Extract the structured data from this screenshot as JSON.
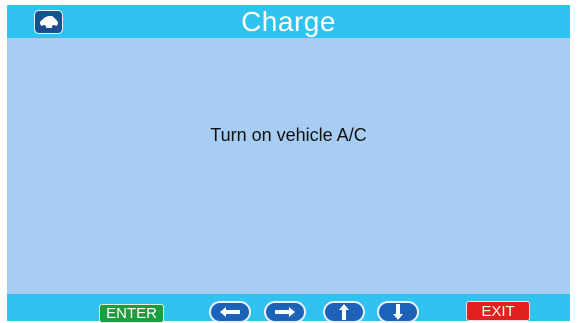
{
  "titlebar": {
    "title": "Charge",
    "logo_icon": "vehicle-logo-icon"
  },
  "main": {
    "message": "Turn on vehicle A/C"
  },
  "buttons": {
    "enter_label": "ENTER",
    "exit_label": "EXIT",
    "arrows": [
      "left-arrow-icon",
      "right-arrow-icon",
      "up-arrow-icon",
      "down-arrow-icon"
    ]
  },
  "colors": {
    "screen_bg": "#a8cdf3",
    "bar_bg": "#31c3f0",
    "enter": "#1e9d3d",
    "exit": "#e0211d",
    "arrow": "#1c62b8"
  }
}
